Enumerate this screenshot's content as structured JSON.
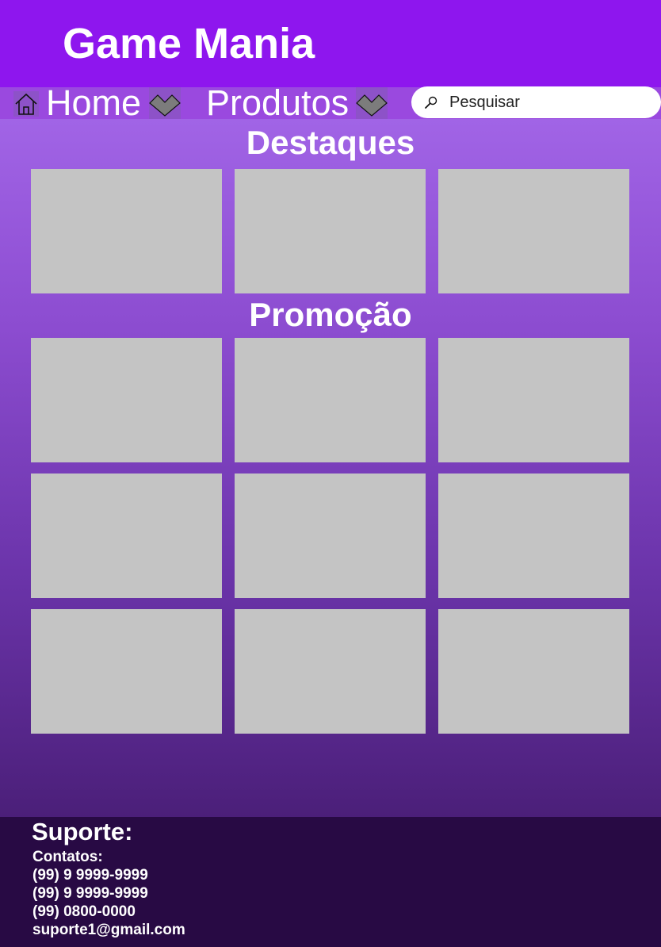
{
  "header": {
    "site_title": "Game Mania"
  },
  "nav": {
    "home_icon": "home-icon",
    "home_label": "Home",
    "produtos_label": "Produtos",
    "dropdown_icon": "chevron-down-icon",
    "search": {
      "icon": "search-icon",
      "placeholder": "Pesquisar"
    }
  },
  "sections": {
    "destaques": {
      "title": "Destaques"
    },
    "promocao": {
      "title": "Promoção"
    }
  },
  "footer": {
    "title": "Suporte:",
    "lines": [
      "Contatos:",
      "(99) 9 9999-9999",
      "(99) 9 9999-9999",
      "(99) 0800-0000",
      "suporte1@gmail.com"
    ]
  },
  "colors": {
    "header_bg": "#8e16ee",
    "nav_bg": "#9a49df",
    "card_placeholder": "#c4c4c4",
    "footer_bg": "#280a44",
    "text": "#ffffff"
  }
}
